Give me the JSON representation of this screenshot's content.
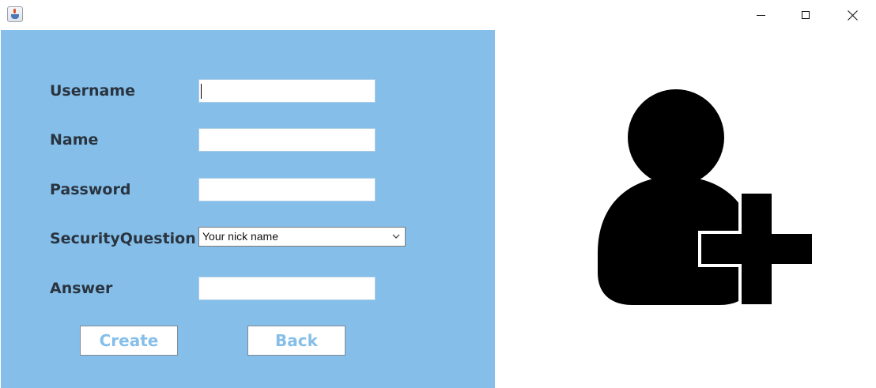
{
  "window": {
    "app_icon": "java-cup-icon",
    "controls": {
      "minimize": "minimize-icon",
      "maximize": "maximize-icon",
      "close": "close-icon"
    }
  },
  "form": {
    "background_color": "#85bfe9",
    "username_label": "Username",
    "username_value": "",
    "name_label": "Name",
    "name_value": "",
    "password_label": "Password",
    "password_value": "",
    "security_question_label": "SecurityQuestion",
    "security_question_selected": "Your nick name",
    "answer_label": "Answer",
    "answer_value": "",
    "create_button": "Create",
    "back_button": "Back",
    "button_text_color": "#85bfe9"
  },
  "illustration": {
    "icon": "add-user-icon",
    "color": "#000000"
  }
}
